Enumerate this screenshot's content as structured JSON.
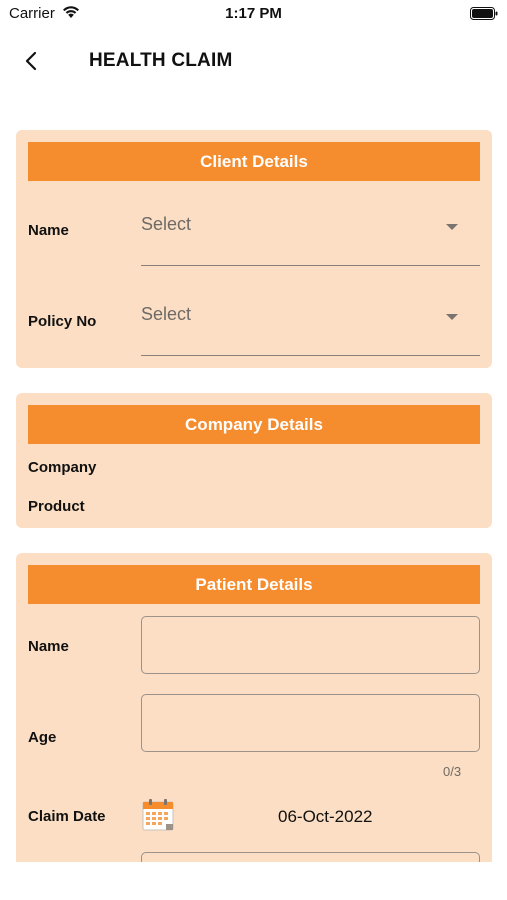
{
  "status_bar": {
    "carrier": "Carrier",
    "time": "1:17 PM"
  },
  "nav": {
    "title": "HEALTH CLAIM"
  },
  "client_details": {
    "header": "Client Details",
    "name_label": "Name",
    "name_value": "Select",
    "policy_label": "Policy No",
    "policy_value": "Select"
  },
  "company_details": {
    "header": "Company Details",
    "company_label": "Company",
    "product_label": "Product"
  },
  "patient_details": {
    "header": "Patient Details",
    "name_label": "Name",
    "name_value": "",
    "age_label": "Age",
    "age_value": "",
    "age_counter": "0/3",
    "claim_date_label": "Claim Date",
    "claim_date_value": "06-Oct-2022"
  },
  "colors": {
    "accent": "#f58d2f",
    "card_bg": "#fbdec4"
  },
  "icons": [
    "wifi-icon",
    "battery-icon",
    "back-chevron-icon",
    "chevron-down-icon",
    "calendar-icon"
  ]
}
